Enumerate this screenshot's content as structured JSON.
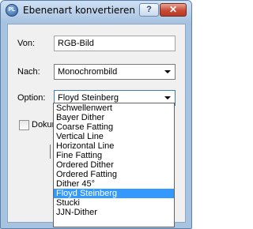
{
  "window": {
    "title": "Ebenenart konvertieren",
    "app_icon_text": "PL",
    "help_label": "?",
    "close_label": "✕"
  },
  "form": {
    "from_label": "Von:",
    "from_value": "RGB-Bild",
    "to_label": "Nach:",
    "to_value": "Monochrombild",
    "option_label": "Option:",
    "option_value": "Floyd Steinberg",
    "checkbox_label": "Dokum"
  },
  "dropdown": {
    "options": [
      "Schwellenwert",
      "Bayer Dither",
      "Coarse Fatting",
      "Vertical Line",
      "Horizontal Line",
      "Fine Fatting",
      "Ordered Dither",
      "Ordered Fatting",
      "Dither 45°",
      "Floyd Steinberg",
      "Stucki",
      "JJN-Dither"
    ],
    "selected": "Floyd Steinberg"
  }
}
